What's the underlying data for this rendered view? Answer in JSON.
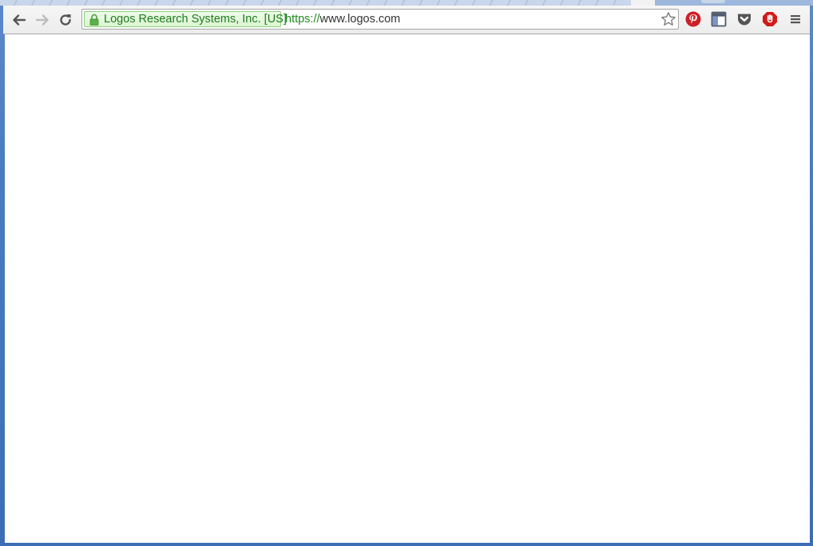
{
  "browser": {
    "toolbar": {
      "back_icon": "arrow-left-icon",
      "forward_icon": "arrow-right-icon",
      "reload_icon": "reload-icon"
    },
    "omnibox": {
      "ev_label": "Logos Research Systems, Inc. [US]",
      "url_scheme": "https://",
      "url_host": "www.logos.com",
      "secure_color": "#1e7a1e"
    },
    "extensions": [
      "pinterest-icon",
      "window-icon",
      "pocket-icon",
      "adblock-icon"
    ],
    "menu_icon": "hamburger-menu-icon"
  },
  "colors": {
    "frame": "#4c7bc0",
    "toolbar": "#f1f1f1",
    "page": "#ffffff"
  }
}
